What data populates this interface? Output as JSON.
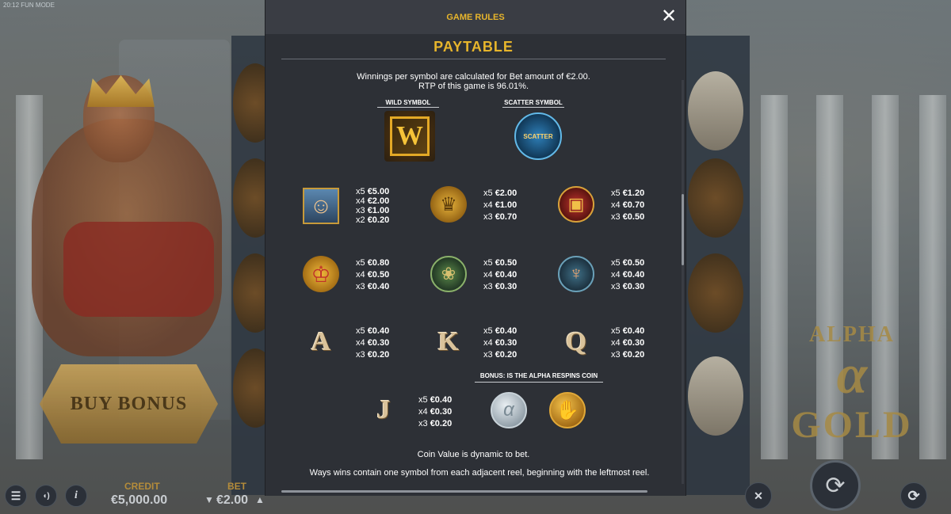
{
  "status_bar": {
    "text": "20:12 FUN MODE"
  },
  "background": {
    "buy_bonus_label": "BUY BONUS",
    "logo": {
      "line1": "ALPHA",
      "symbol": "α",
      "line2": "GOLD"
    }
  },
  "bottom_bar": {
    "menu_icon": "☰",
    "sound_icon": "◖)",
    "info_icon": "i",
    "credit_label": "CREDIT",
    "credit_value": "€5,000.00",
    "bet_label": "BET",
    "bet_value": "€2.00",
    "bet_decrease": "▼",
    "bet_increase": "▲",
    "spin_icon": "⟳",
    "turbo_icon": "✕",
    "autoplay_icon": "⟳"
  },
  "modal": {
    "title": "GAME RULES",
    "close_icon": "✕",
    "paytable_title": "PAYTABLE",
    "info_line1": "Winnings per symbol are calculated for Bet amount of €2.00.",
    "info_line2": "RTP of this game is 96.01%.",
    "wild_label": "WILD SYMBOL",
    "wild_glyph": "W",
    "scatter_label": "SCATTER SYMBOL",
    "scatter_text": "SCATTER",
    "symbols": [
      {
        "name": "zeus-portrait",
        "glyph": "☺",
        "pays": [
          [
            "x5",
            "€5.00"
          ],
          [
            "x4",
            "€2.00"
          ],
          [
            "x3",
            "€1.00"
          ],
          [
            "x2",
            "€0.20"
          ]
        ]
      },
      {
        "name": "bust-coin",
        "glyph": "♛",
        "pays": [
          [
            "x5",
            "€2.00"
          ],
          [
            "x4",
            "€1.00"
          ],
          [
            "x3",
            "€0.70"
          ]
        ]
      },
      {
        "name": "treasure-chest",
        "glyph": "▣",
        "pays": [
          [
            "x5",
            "€1.20"
          ],
          [
            "x4",
            "€0.70"
          ],
          [
            "x3",
            "€0.50"
          ]
        ]
      },
      {
        "name": "crown-coin",
        "glyph": "♔",
        "pays": [
          [
            "x5",
            "€0.80"
          ],
          [
            "x4",
            "€0.50"
          ],
          [
            "x3",
            "€0.40"
          ]
        ]
      },
      {
        "name": "grapes-coin",
        "glyph": "❀",
        "pays": [
          [
            "x5",
            "€0.50"
          ],
          [
            "x4",
            "€0.40"
          ],
          [
            "x3",
            "€0.30"
          ]
        ]
      },
      {
        "name": "harp-coin",
        "glyph": "♆",
        "pays": [
          [
            "x5",
            "€0.50"
          ],
          [
            "x4",
            "€0.40"
          ],
          [
            "x3",
            "€0.30"
          ]
        ]
      },
      {
        "name": "letter-a",
        "glyph": "A",
        "pays": [
          [
            "x5",
            "€0.40"
          ],
          [
            "x4",
            "€0.30"
          ],
          [
            "x3",
            "€0.20"
          ]
        ]
      },
      {
        "name": "letter-k",
        "glyph": "K",
        "pays": [
          [
            "x5",
            "€0.40"
          ],
          [
            "x4",
            "€0.30"
          ],
          [
            "x3",
            "€0.20"
          ]
        ]
      },
      {
        "name": "letter-q",
        "glyph": "Q",
        "pays": [
          [
            "x5",
            "€0.40"
          ],
          [
            "x4",
            "€0.30"
          ],
          [
            "x3",
            "€0.20"
          ]
        ]
      },
      {
        "name": "letter-j",
        "glyph": "J",
        "pays": [
          [
            "x5",
            "€0.40"
          ],
          [
            "x4",
            "€0.30"
          ],
          [
            "x3",
            "€0.20"
          ]
        ]
      }
    ],
    "bonus_label": "BONUS: IS THE ALPHA RESPINS COIN",
    "bonus_coin1": "α",
    "bonus_coin2": "✋",
    "coin_value_text": "Coin Value is dynamic to bet.",
    "ways_text": "Ways wins contain one symbol from each adjacent reel, beginning with the leftmost reel."
  },
  "colors": {
    "accent_gold": "#e7b52c",
    "modal_bg": "#2d3036",
    "header_bg": "#3a3d44"
  }
}
